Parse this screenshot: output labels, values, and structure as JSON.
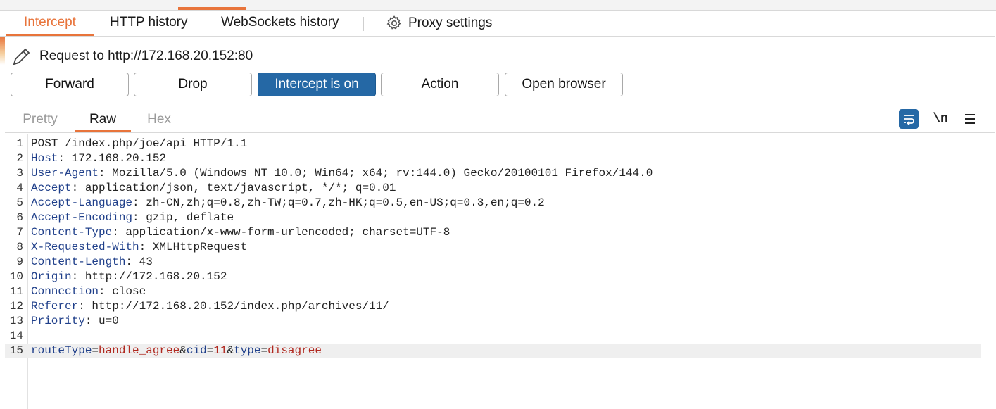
{
  "tabs": [
    "Intercept",
    "HTTP history",
    "WebSockets history"
  ],
  "proxy_settings_label": "Proxy settings",
  "request_line": "Request to http://172.168.20.152:80",
  "buttons": {
    "forward": "Forward",
    "drop": "Drop",
    "intercept": "Intercept is on",
    "action": "Action",
    "open_browser": "Open browser"
  },
  "view_tabs": [
    "Pretty",
    "Raw",
    "Hex"
  ],
  "newline_toggle_label": "\\n",
  "icons": {
    "settings": "gear-icon",
    "request": "pencil-icon",
    "wrap": "word-wrap-icon",
    "menu": "hamburger-menu-icon"
  },
  "colors": {
    "accent": "#e8743b",
    "primary_button": "#2568a5",
    "header_key": "#1f3f8a",
    "param_value": "#b0281f"
  },
  "request": {
    "request_line": "POST /index.php/joe/api HTTP/1.1",
    "headers": [
      {
        "name": "Host",
        "value": "172.168.20.152"
      },
      {
        "name": "User-Agent",
        "value": "Mozilla/5.0 (Windows NT 10.0; Win64; x64; rv:144.0) Gecko/20100101 Firefox/144.0"
      },
      {
        "name": "Accept",
        "value": "application/json, text/javascript, */*; q=0.01"
      },
      {
        "name": "Accept-Language",
        "value": "zh-CN,zh;q=0.8,zh-TW;q=0.7,zh-HK;q=0.5,en-US;q=0.3,en;q=0.2"
      },
      {
        "name": "Accept-Encoding",
        "value": "gzip, deflate"
      },
      {
        "name": "Content-Type",
        "value": "application/x-www-form-urlencoded; charset=UTF-8"
      },
      {
        "name": "X-Requested-With",
        "value": "XMLHttpRequest"
      },
      {
        "name": "Content-Length",
        "value": "43"
      },
      {
        "name": "Origin",
        "value": "http://172.168.20.152"
      },
      {
        "name": "Connection",
        "value": "close"
      },
      {
        "name": "Referer",
        "value": "http://172.168.20.152/index.php/archives/11/"
      },
      {
        "name": "Priority",
        "value": "u=0"
      }
    ],
    "body_params": [
      {
        "name": "routeType",
        "value": "handle_agree"
      },
      {
        "name": "cid",
        "value": "11"
      },
      {
        "name": "type",
        "value": "disagree"
      }
    ]
  }
}
